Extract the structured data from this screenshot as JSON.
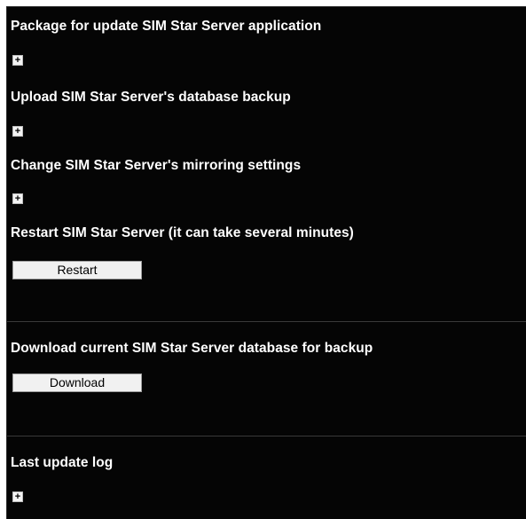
{
  "sections": {
    "update_package": {
      "title": "Package for update SIM Star Server application",
      "expander": "+"
    },
    "upload_backup": {
      "title": "Upload SIM Star Server's database backup",
      "expander": "+"
    },
    "mirroring": {
      "title": "Change SIM Star Server's mirroring settings",
      "expander": "+"
    },
    "restart": {
      "title": "Restart SIM Star Server (it can take several minutes)",
      "button_label": "Restart"
    },
    "download": {
      "title": "Download current SIM Star Server database for backup",
      "button_label": "Download"
    },
    "last_update_log": {
      "title": "Last update log",
      "expander": "+"
    }
  },
  "colors": {
    "panel_background": "#050505",
    "text": "#ffffff",
    "button_background": "#f1f1f1",
    "divider": "#3a3a3a"
  }
}
